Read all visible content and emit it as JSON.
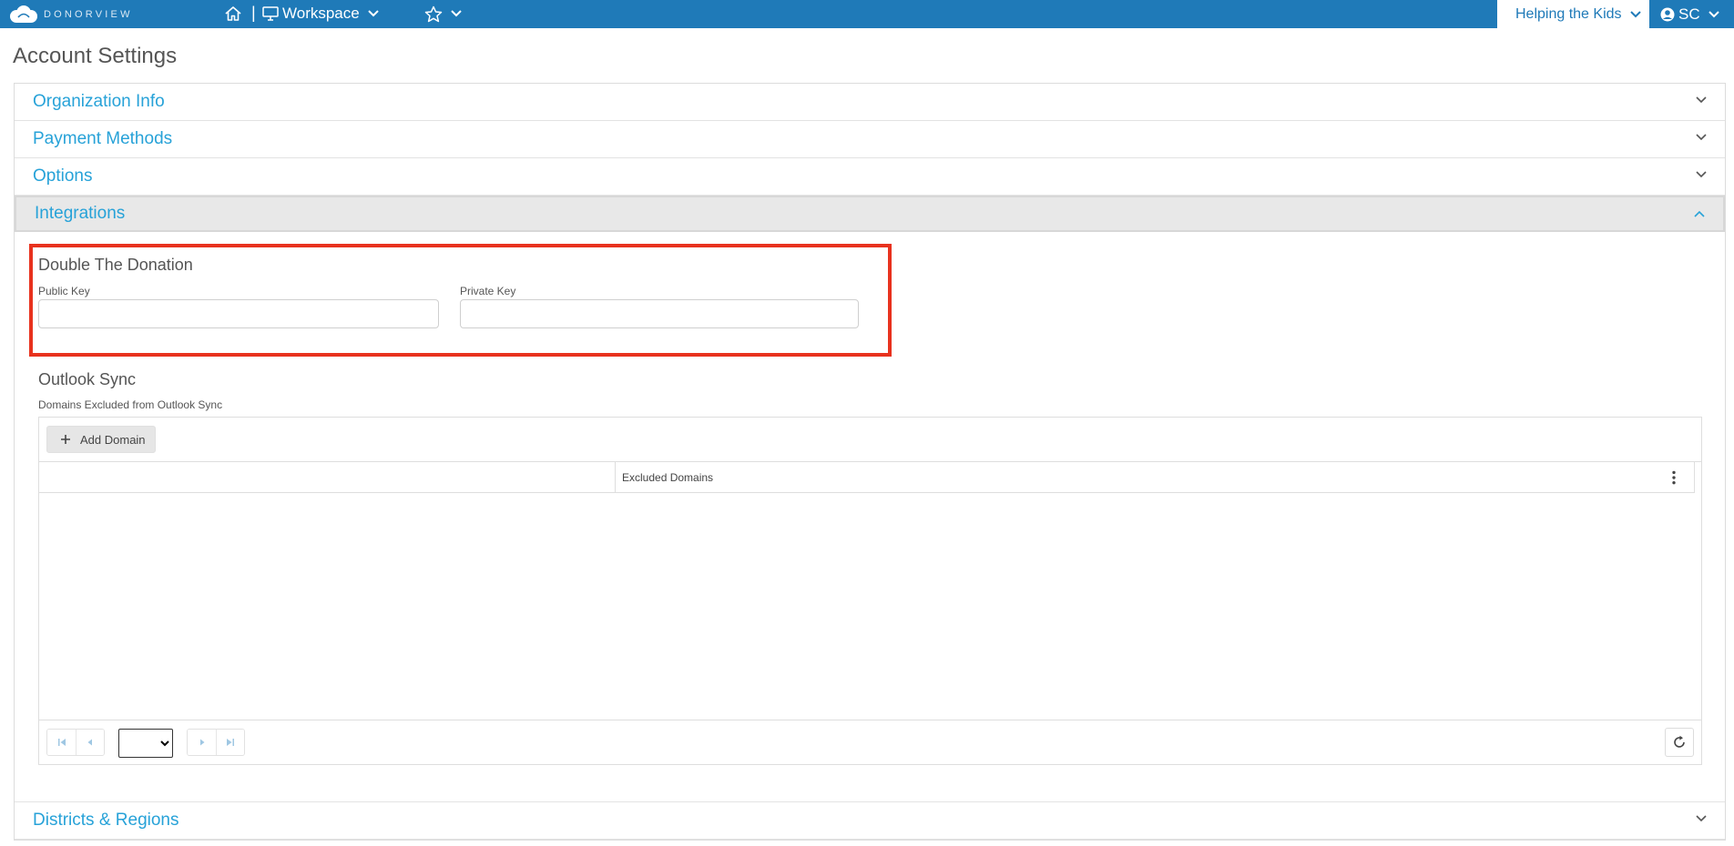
{
  "topbar": {
    "brand": "DONORVIEW",
    "workspace_label": "Workspace",
    "org_name": "Helping the Kids",
    "user_initials": "SC",
    "bg_color": "#1f7ab8"
  },
  "page": {
    "title": "Account Settings"
  },
  "accordion": {
    "sections": [
      {
        "label": "Organization Info",
        "expanded": false
      },
      {
        "label": "Payment Methods",
        "expanded": false
      },
      {
        "label": "Options",
        "expanded": false
      },
      {
        "label": "Integrations",
        "expanded": true
      },
      {
        "label": "Districts & Regions",
        "expanded": false
      }
    ],
    "title_color": "#27a2d8"
  },
  "integrations": {
    "double_the_donation": {
      "title": "Double The Donation",
      "public_key_label": "Public Key",
      "public_key_value": "",
      "private_key_label": "Private Key",
      "private_key_value": ""
    },
    "outlook_sync": {
      "title": "Outlook Sync",
      "domains_label": "Domains Excluded from Outlook Sync",
      "add_domain_label": "Add Domain",
      "columns": [
        "",
        "Excluded Domains"
      ],
      "rows": [],
      "page_size_selected": ""
    },
    "highlight_color": "#e8321e"
  },
  "icons": {
    "home": "home-icon",
    "monitor": "monitor-icon",
    "star": "star-icon",
    "user": "user-circle-icon",
    "chevron": "chevron-down-icon",
    "add": "plus-icon",
    "refresh": "refresh-icon"
  }
}
